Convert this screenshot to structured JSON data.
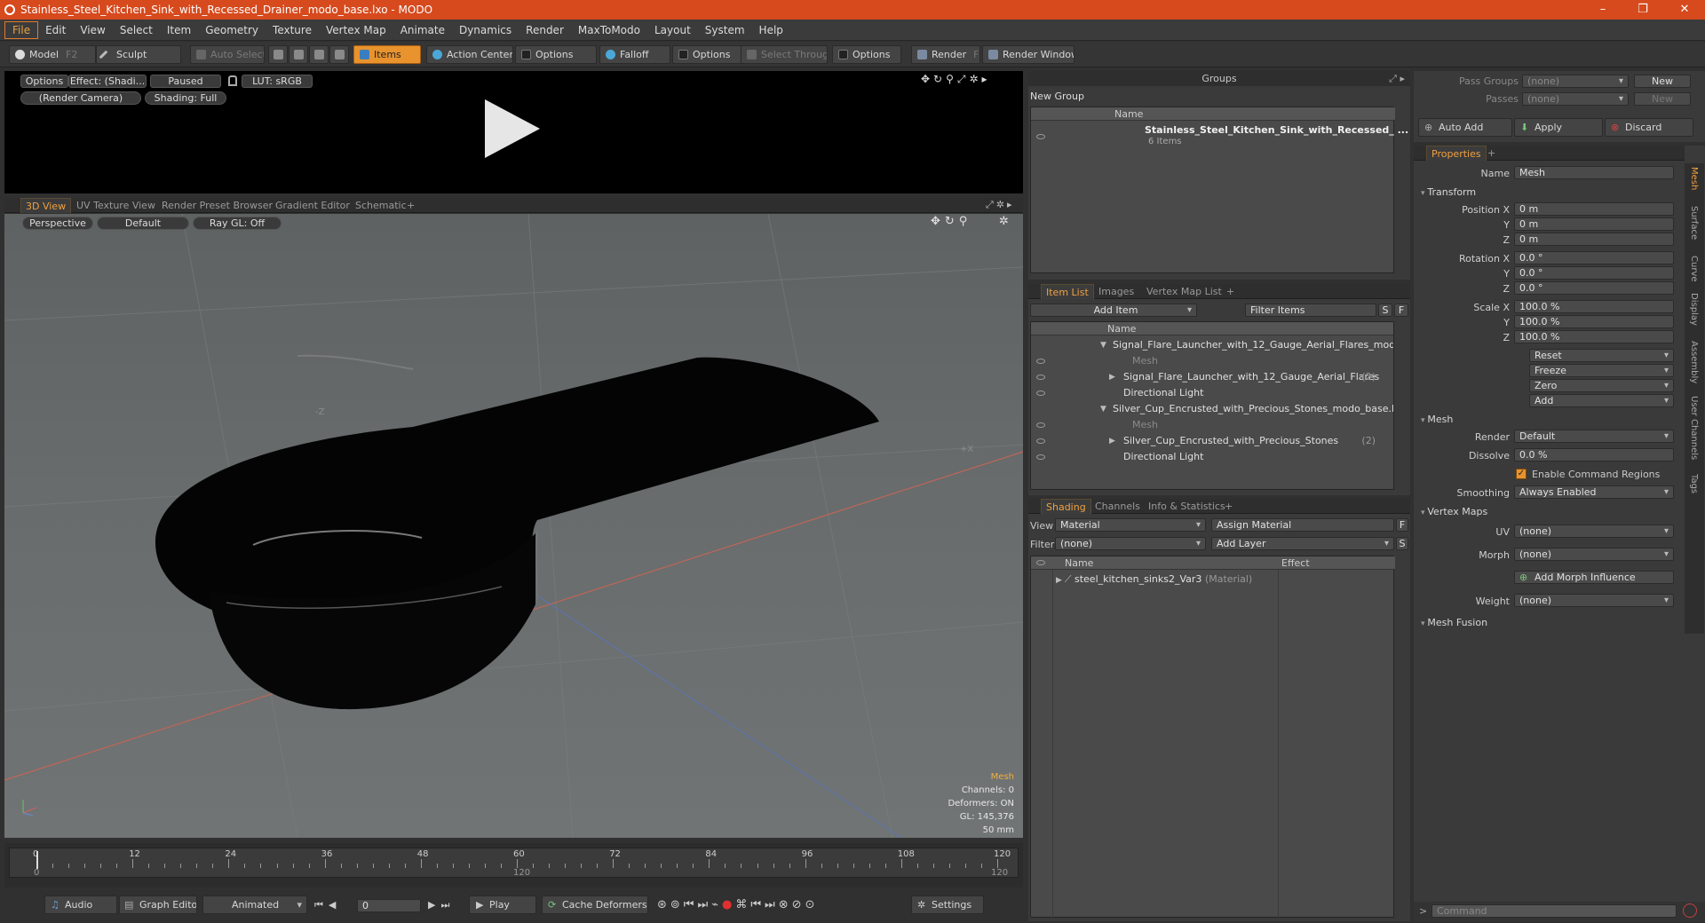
{
  "window": {
    "title": "Stainless_Steel_Kitchen_Sink_with_Recessed_Drainer_modo_base.lxo - MODO",
    "minimize": "–",
    "maximize": "❐",
    "close": "✕"
  },
  "menu": [
    "File",
    "Edit",
    "View",
    "Select",
    "Item",
    "Geometry",
    "Texture",
    "Vertex Map",
    "Animate",
    "Dynamics",
    "Render",
    "MaxToModo",
    "Layout",
    "System",
    "Help"
  ],
  "toolbar": {
    "model": "Model",
    "model_key": "F2",
    "sculpt": "Sculpt",
    "auto_select": "Auto Select",
    "items": "Items",
    "action_center": "Action Center",
    "options1": "Options",
    "falloff": "Falloff",
    "options2": "Options",
    "select_through": "Select Through",
    "options3": "Options",
    "render": "Render",
    "render_key": "F9",
    "render_window": "Render Window"
  },
  "preview": {
    "options": "Options",
    "effect": "Effect: (Shadi...",
    "paused": "Paused",
    "lut": "LUT: sRGB",
    "camera": "(Render Camera)",
    "shading": "Shading: Full"
  },
  "viewport_tabs": [
    "3D View",
    "UV Texture View",
    "Render Preset Browser",
    "Gradient Editor",
    "Schematic",
    "+"
  ],
  "viewport": {
    "perspective": "Perspective",
    "default": "Default",
    "raygl": "Ray GL: Off",
    "axis_z": "-Z",
    "axis_x": "+X",
    "info": {
      "item": "Mesh",
      "channels": "Channels: 0",
      "deformers": "Deformers: ON",
      "gl": "GL: 145,376",
      "focal": "50 mm"
    }
  },
  "timeline": {
    "labels": [
      "0",
      "12",
      "24",
      "36",
      "48",
      "60",
      "72",
      "84",
      "96",
      "108",
      "120"
    ],
    "sub_left": "0",
    "sub_mid": "120",
    "sub_right": "120"
  },
  "bottombar": {
    "audio": "Audio",
    "graph_editor": "Graph Editor",
    "animated": "Animated",
    "frame": "0",
    "play": "Play",
    "cache_deformers": "Cache Deformers",
    "settings": "Settings"
  },
  "groups": {
    "title": "Groups",
    "new_group": "New Group",
    "col_name": "Name",
    "item_name": "Stainless_Steel_Kitchen_Sink_with_Recessed_ ...",
    "item_count": "6 Items"
  },
  "passes": {
    "pass_groups_label": "Pass Groups",
    "pass_groups_value": "(none)",
    "new1": "New",
    "passes_label": "Passes",
    "passes_value": "(none)",
    "new2": "New"
  },
  "actions": {
    "auto_add": "Auto Add",
    "apply": "Apply",
    "discard": "Discard"
  },
  "item_list": {
    "tabs": [
      "Item List",
      "Images",
      "Vertex Map List",
      "+"
    ],
    "add_item": "Add Item",
    "filter_items": "Filter Items",
    "s": "S",
    "f": "F",
    "col_name": "Name",
    "rows": [
      {
        "text": "Signal_Flare_Launcher_with_12_Gauge_Aerial_Flares_mod...",
        "indent": 0,
        "arrow": "▼",
        "dim": false
      },
      {
        "text": "Mesh",
        "indent": 2,
        "arrow": "",
        "dim": true
      },
      {
        "text": "Signal_Flare_Launcher_with_12_Gauge_Aerial_Flares",
        "count": "(2)",
        "indent": 1,
        "arrow": "▶",
        "dim": false
      },
      {
        "text": "Directional Light",
        "indent": 1,
        "arrow": "",
        "dim": false
      },
      {
        "text": "Silver_Cup_Encrusted_with_Precious_Stones_modo_base.lxo",
        "indent": 0,
        "arrow": "▼",
        "dim": false
      },
      {
        "text": "Mesh",
        "indent": 2,
        "arrow": "",
        "dim": true
      },
      {
        "text": "Silver_Cup_Encrusted_with_Precious_Stones",
        "count": "(2)",
        "indent": 1,
        "arrow": "▶",
        "dim": false
      },
      {
        "text": "Directional Light",
        "indent": 1,
        "arrow": "",
        "dim": false
      }
    ]
  },
  "shading": {
    "tabs": [
      "Shading",
      "Channels",
      "Info & Statistics",
      "+"
    ],
    "view_label": "View",
    "view_value": "Material",
    "assign_material": "Assign Material",
    "f": "F",
    "filter_label": "Filter",
    "filter_value": "(none)",
    "add_layer": "Add Layer",
    "s": "S",
    "col_name": "Name",
    "col_effect": "Effect",
    "material": "steel_kitchen_sinks2_Var3",
    "material_type": "(Material)"
  },
  "properties": {
    "tab": "Properties",
    "plus": "+",
    "name_label": "Name",
    "name_value": "Mesh",
    "transform": "Transform",
    "position_label": "Position X",
    "y": "Y",
    "z": "Z",
    "pos": [
      "0 m",
      "0 m",
      "0 m"
    ],
    "rotation_label": "Rotation X",
    "rot": [
      "0.0 °",
      "0.0 °",
      "0.0 °"
    ],
    "scale_label": "Scale X",
    "scl": [
      "100.0 %",
      "100.0 %",
      "100.0 %"
    ],
    "reset": "Reset",
    "freeze": "Freeze",
    "zero": "Zero",
    "add": "Add",
    "mesh": "Mesh",
    "render_label": "Render",
    "render_value": "Default",
    "dissolve_label": "Dissolve",
    "dissolve_value": "0.0 %",
    "enable_cmd": "Enable Command Regions",
    "smoothing_label": "Smoothing",
    "smoothing_value": "Always Enabled",
    "vertex_maps": "Vertex Maps",
    "uv_label": "UV",
    "uv_value": "(none)",
    "morph_label": "Morph",
    "morph_value": "(none)",
    "add_morph": "Add Morph Influence",
    "weight_label": "Weight",
    "weight_value": "(none)",
    "mesh_fusion": "Mesh Fusion",
    "side_tabs": [
      "Mesh",
      "Surface",
      "Curve",
      "Display",
      "Assembly",
      "User Channels",
      "Tags"
    ]
  },
  "command": {
    "placeholder": "Command",
    "prompt": ">"
  },
  "colors": {
    "accent": "#e8932e",
    "title_bar": "#d64a1e"
  }
}
